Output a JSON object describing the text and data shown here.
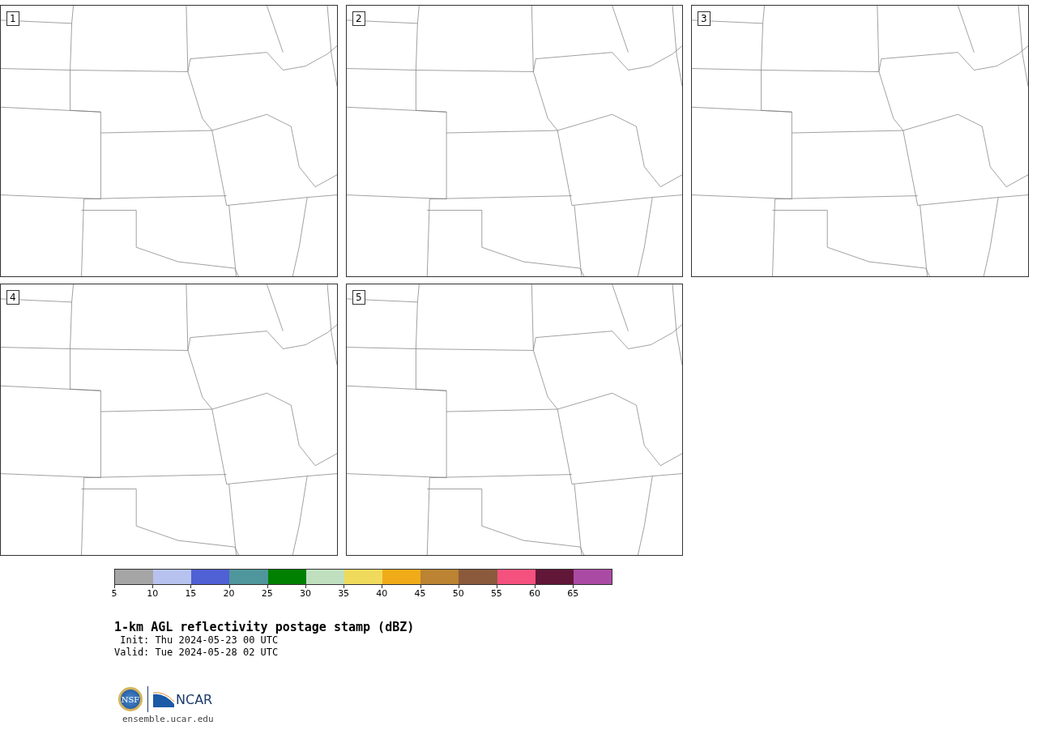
{
  "panels": [
    {
      "label": "1"
    },
    {
      "label": "2"
    },
    {
      "label": "3"
    },
    {
      "label": "4"
    },
    {
      "label": "5"
    }
  ],
  "colorbar": {
    "segments": [
      {
        "color": "#a5a5a5"
      },
      {
        "color": "#b7c3ee"
      },
      {
        "color": "#5060d5"
      },
      {
        "color": "#4f969c"
      },
      {
        "color": "#008000"
      },
      {
        "color": "#bfdfbf"
      },
      {
        "color": "#f0da5c"
      },
      {
        "color": "#f0ac18"
      },
      {
        "color": "#bb8332"
      },
      {
        "color": "#8b5a3c"
      },
      {
        "color": "#f5517e"
      },
      {
        "color": "#621638"
      },
      {
        "color": "#ab4aa5"
      }
    ],
    "ticks": [
      "5",
      "10",
      "15",
      "20",
      "25",
      "30",
      "35",
      "40",
      "45",
      "50",
      "55",
      "60",
      "65"
    ]
  },
  "title": "1-km AGL reflectivity postage stamp (dBZ)",
  "init": " Init: Thu 2024-05-23 00 UTC",
  "valid": "Valid: Tue 2024-05-28 02 UTC",
  "logos": {
    "left": "NSF",
    "right": "NCAR"
  },
  "footer": "ensemble.ucar.edu"
}
